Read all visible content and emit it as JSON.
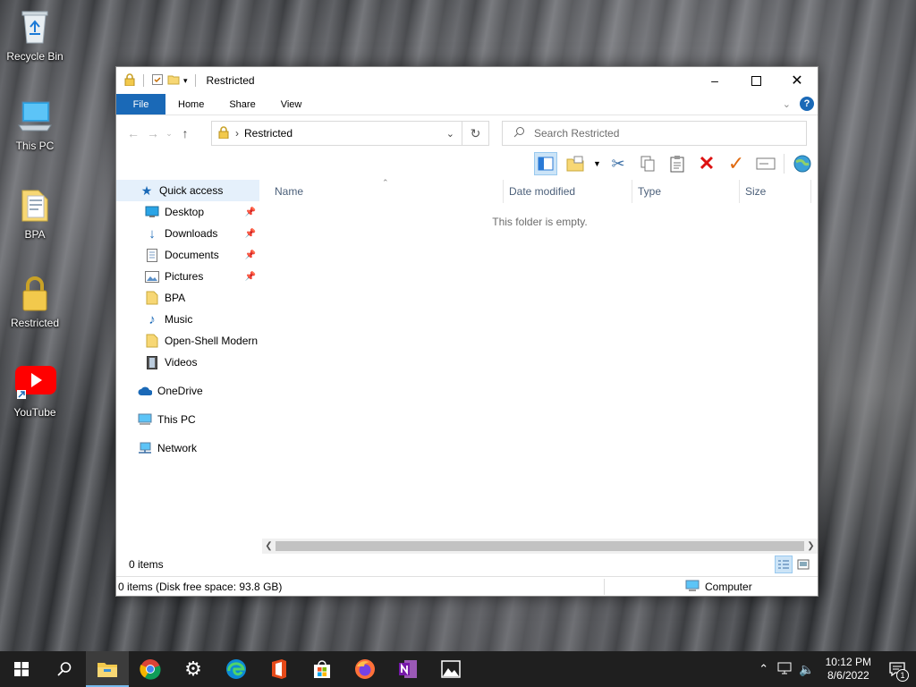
{
  "desktop": {
    "icons": [
      {
        "label": "Recycle Bin",
        "icon": "recycle-bin-icon"
      },
      {
        "label": "This PC",
        "icon": "computer-icon"
      },
      {
        "label": "BPA",
        "icon": "folder-icon"
      },
      {
        "label": "Restricted",
        "icon": "lock-icon"
      },
      {
        "label": "YouTube",
        "icon": "youtube-icon"
      }
    ]
  },
  "window": {
    "title": "Restricted",
    "ribbon_tabs": [
      "File",
      "Home",
      "Share",
      "View"
    ],
    "address_path": "Restricted",
    "search_placeholder": "Search Restricted",
    "nav": {
      "quick_access": "Quick access",
      "items": [
        {
          "label": "Desktop",
          "pinned": true
        },
        {
          "label": "Downloads",
          "pinned": true
        },
        {
          "label": "Documents",
          "pinned": true
        },
        {
          "label": "Pictures",
          "pinned": true
        },
        {
          "label": "BPA",
          "pinned": false
        },
        {
          "label": "Music",
          "pinned": false
        },
        {
          "label": "Open-Shell Modern",
          "pinned": false
        },
        {
          "label": "Videos",
          "pinned": false
        }
      ],
      "onedrive": "OneDrive",
      "this_pc": "This PC",
      "network": "Network"
    },
    "columns": [
      "Name",
      "Date modified",
      "Type",
      "Size"
    ],
    "empty_message": "This folder is empty.",
    "item_count": "0 items",
    "status_info": "0 items (Disk free space: 93.8 GB)",
    "status_location": "Computer"
  },
  "taskbar": {
    "apps": [
      "start-icon",
      "search-icon",
      "file-explorer-icon",
      "chrome-icon",
      "settings-icon",
      "edge-icon",
      "office-icon",
      "store-icon",
      "firefox-icon",
      "onenote-icon",
      "photos-icon"
    ],
    "time": "10:12 PM",
    "date": "8/6/2022",
    "notification_count": "1"
  },
  "colors": {
    "accent": "#1a69b7",
    "selection": "#e5f0fb",
    "taskbar": "#1f1f1f"
  }
}
